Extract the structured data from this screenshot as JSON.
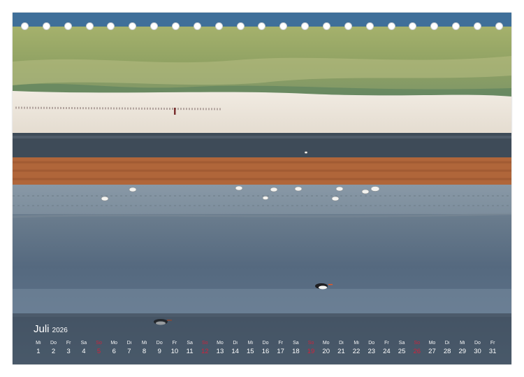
{
  "calendar": {
    "month": "Juli",
    "year": "2026",
    "days": [
      {
        "name": "Mi",
        "date": "1"
      },
      {
        "name": "Do",
        "date": "2"
      },
      {
        "name": "Fr",
        "date": "3"
      },
      {
        "name": "Sa",
        "date": "4"
      },
      {
        "name": "So",
        "date": "5",
        "sunday": true
      },
      {
        "name": "Mo",
        "date": "6"
      },
      {
        "name": "Di",
        "date": "7"
      },
      {
        "name": "Mi",
        "date": "8"
      },
      {
        "name": "Do",
        "date": "9"
      },
      {
        "name": "Fr",
        "date": "10"
      },
      {
        "name": "Sa",
        "date": "11"
      },
      {
        "name": "So",
        "date": "12",
        "sunday": true
      },
      {
        "name": "Mo",
        "date": "13"
      },
      {
        "name": "Di",
        "date": "14"
      },
      {
        "name": "Mi",
        "date": "15"
      },
      {
        "name": "Do",
        "date": "16"
      },
      {
        "name": "Fr",
        "date": "17"
      },
      {
        "name": "Sa",
        "date": "18"
      },
      {
        "name": "So",
        "date": "19",
        "sunday": true
      },
      {
        "name": "Mo",
        "date": "20"
      },
      {
        "name": "Di",
        "date": "21"
      },
      {
        "name": "Mi",
        "date": "22"
      },
      {
        "name": "Do",
        "date": "23"
      },
      {
        "name": "Fr",
        "date": "24"
      },
      {
        "name": "Sa",
        "date": "25"
      },
      {
        "name": "So",
        "date": "26",
        "sunday": true
      },
      {
        "name": "Mo",
        "date": "27"
      },
      {
        "name": "Di",
        "date": "28"
      },
      {
        "name": "Mi",
        "date": "29"
      },
      {
        "name": "Do",
        "date": "30"
      },
      {
        "name": "Fr",
        "date": "31"
      }
    ]
  },
  "colors": {
    "sunday": "#d3203a",
    "dune_grass": "#9aa866",
    "sand": "#e9e2d6",
    "seaweed": "#b0663a",
    "mudflat": "#5f7388"
  }
}
